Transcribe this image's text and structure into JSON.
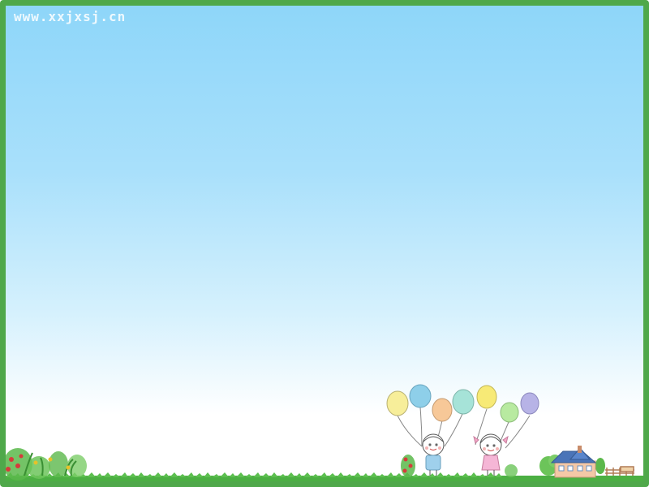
{
  "watermark": {
    "text": "www.xxjxsj.cn"
  },
  "colors": {
    "frame": "#4fa84a",
    "sky_top": "#8ed6f9",
    "grass": "#4caf43",
    "balloons": [
      "#f7ee9a",
      "#8ecfe9",
      "#f7c898",
      "#a6e3d8",
      "#f7ea76",
      "#b8eaa0",
      "#b7b3e6"
    ]
  },
  "icons": [
    "grass-strip-icon",
    "left-bush-icon",
    "flower-bush-icon",
    "balloon-boy-icon",
    "balloon-girl-icon",
    "house-icon",
    "tree-icon",
    "fence-icon"
  ]
}
